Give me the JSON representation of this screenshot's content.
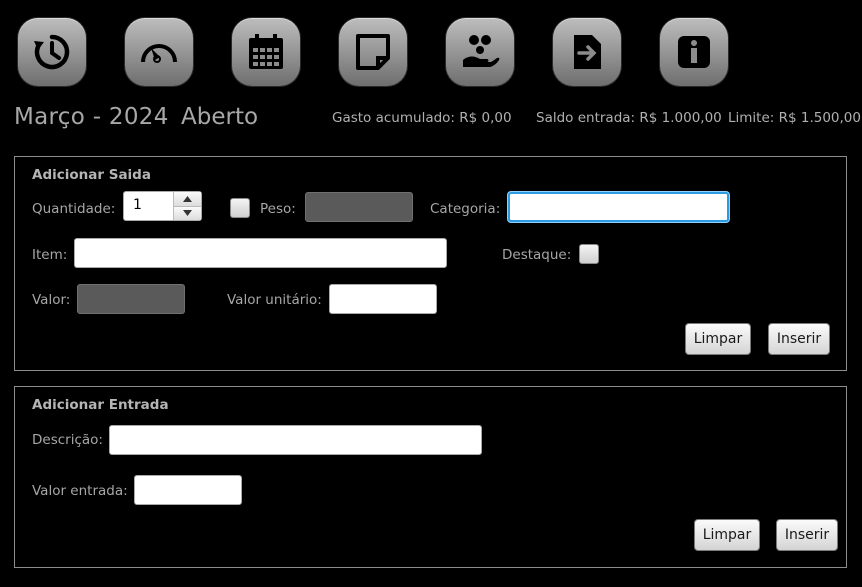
{
  "toolbar": {
    "buttons": [
      {
        "icon": "history-icon"
      },
      {
        "icon": "gauge-icon"
      },
      {
        "icon": "calendar-icon"
      },
      {
        "icon": "note-icon"
      },
      {
        "icon": "money-hand-icon"
      },
      {
        "icon": "export-file-icon"
      },
      {
        "icon": "info-icon"
      }
    ]
  },
  "header": {
    "month": "Março - 2024",
    "status": "Aberto",
    "gasto": "Gasto acumulado: R$ 0,00",
    "saldo": "Saldo entrada: R$ 1.000,00",
    "limite": "Limite: R$ 1.500,00"
  },
  "saida": {
    "title": "Adicionar Saida",
    "quantidade_label": "Quantidade:",
    "quantidade_value": "1",
    "peso_label": "Peso:",
    "categoria_label": "Categoria:",
    "item_label": "Item:",
    "destaque_label": "Destaque:",
    "valor_label": "Valor:",
    "valor_unitario_label": "Valor unitário:",
    "limpar": "Limpar",
    "inserir": "Inserir"
  },
  "entrada": {
    "title": "Adicionar Entrada",
    "descricao_label": "Descrição:",
    "valor_label": "Valor entrada:",
    "limpar": "Limpar",
    "inserir": "Inserir"
  },
  "colors": {
    "background": "#000000",
    "focus": "#2d9be3",
    "disabled_field": "#5a5a5a"
  }
}
